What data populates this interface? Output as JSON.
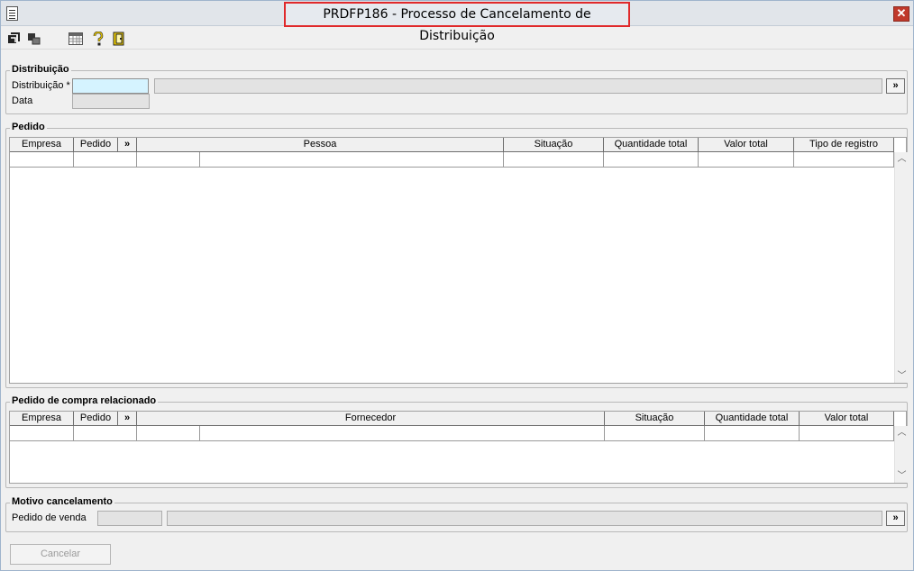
{
  "window": {
    "title": "PRDFP186 - Processo de Cancelamento de Distribuição",
    "close_label": "✕"
  },
  "toolbar": {
    "buttons": [
      "execute-icon",
      "export-icon",
      "calendar-grid-icon",
      "help-icon",
      "exit-door-icon"
    ]
  },
  "distribuicao": {
    "legend": "Distribuição",
    "distribuicao_label": "Distribuição *",
    "distribuicao_value": "",
    "descricao_value": "",
    "data_label": "Data",
    "data_value": "",
    "lookup_label": "»"
  },
  "pedido": {
    "legend": "Pedido",
    "columns": {
      "empresa": "Empresa",
      "pedido": "Pedido",
      "expand": "»",
      "pessoa": "Pessoa",
      "situacao": "Situação",
      "quantidade_total": "Quantidade total",
      "valor_total": "Valor total",
      "tipo_registro": "Tipo de registro"
    }
  },
  "pedido_compra": {
    "legend": "Pedido de compra relacionado",
    "columns": {
      "empresa": "Empresa",
      "pedido": "Pedido",
      "expand": "»",
      "fornecedor": "Fornecedor",
      "situacao": "Situação",
      "quantidade_total": "Quantidade total",
      "valor_total": "Valor total"
    }
  },
  "motivo": {
    "legend": "Motivo cancelamento",
    "pedido_venda_label": "Pedido de venda",
    "pedido_venda_value": "",
    "descricao_value": "",
    "lookup_label": "»"
  },
  "actions": {
    "cancel_label": "Cancelar"
  },
  "colors": {
    "required_field": "#d5f3ff",
    "title_highlight": "#e0292b"
  }
}
